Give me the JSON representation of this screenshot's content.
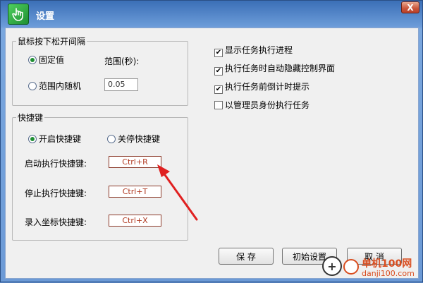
{
  "window": {
    "title": "设置",
    "close_label": "X"
  },
  "interval_group": {
    "legend": "鼠标按下松开间隔",
    "fixed_label": "固定值",
    "range_label": "范围(秒):",
    "random_label": "范围内随机",
    "range_value": "0.05",
    "selected": "fixed"
  },
  "hotkey_group": {
    "legend": "快捷键",
    "enable_label": "开启快捷键",
    "disable_label": "关停快捷键",
    "selected": "enable",
    "start_label": "启动执行快捷键:",
    "start_value": "Ctrl+R",
    "stop_label": "停止执行快捷键:",
    "stop_value": "Ctrl+T",
    "record_label": "录入坐标快捷键:",
    "record_value": "Ctrl+X"
  },
  "options": [
    {
      "label": "显示任务执行进程",
      "checked": true
    },
    {
      "label": "执行任务时自动隐藏控制界面",
      "checked": true
    },
    {
      "label": "执行任务前倒计时提示",
      "checked": true
    },
    {
      "label": "以管理员身份执行任务",
      "checked": false
    }
  ],
  "buttons": {
    "save": "保 存",
    "reset": "初始设置",
    "cancel": "取 消"
  },
  "watermark": {
    "text": "单机100网",
    "sub": "danji100.com"
  },
  "colors": {
    "accent_green": "#1f8f33",
    "arrow_red": "#e02020",
    "hotkey_text": "#b03a22"
  }
}
